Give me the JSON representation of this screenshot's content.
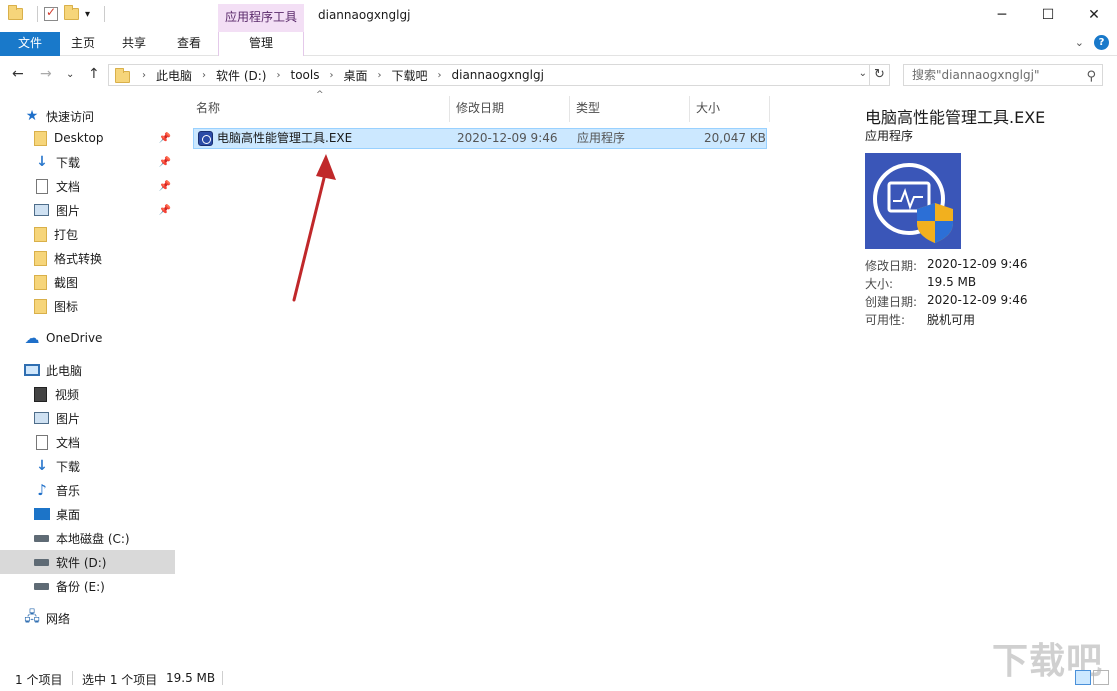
{
  "window": {
    "title": "diannaogxnglgj",
    "context_tab_group": "应用程序工具"
  },
  "ribbon": {
    "tabs": [
      {
        "label": "文件"
      },
      {
        "label": "主页"
      },
      {
        "label": "共享"
      },
      {
        "label": "查看"
      },
      {
        "label": "管理"
      }
    ]
  },
  "address": {
    "crumbs": [
      "此电脑",
      "软件 (D:)",
      "tools",
      "桌面",
      "下载吧",
      "diannaogxnglgj"
    ],
    "search_placeholder": "搜索\"diannaogxnglgj\""
  },
  "sidebar": {
    "quick_access": "快速访问",
    "quick_items": [
      "Desktop",
      "下载",
      "文档",
      "图片",
      "打包",
      "格式转换",
      "截图",
      "图标"
    ],
    "onedrive": "OneDrive",
    "this_pc": "此电脑",
    "pc_items": [
      "视频",
      "图片",
      "文档",
      "下载",
      "音乐",
      "桌面",
      "本地磁盘 (C:)",
      "软件 (D:)",
      "备份 (E:)"
    ],
    "network": "网络"
  },
  "columns": {
    "name": "名称",
    "modified": "修改日期",
    "type": "类型",
    "size": "大小"
  },
  "files": [
    {
      "name": "电脑高性能管理工具.EXE",
      "modified": "2020-12-09 9:46",
      "type": "应用程序",
      "size": "20,047 KB"
    }
  ],
  "details": {
    "title": "电脑高性能管理工具.EXE",
    "type": "应用程序",
    "fields": [
      {
        "key": "修改日期:",
        "value": "2020-12-09 9:46"
      },
      {
        "key": "大小:",
        "value": "19.5 MB"
      },
      {
        "key": "创建日期:",
        "value": "2020-12-09 9:46"
      },
      {
        "key": "可用性:",
        "value": "脱机可用"
      }
    ]
  },
  "status": {
    "count": "1 个项目",
    "selected": "选中 1 个项目",
    "size": "19.5 MB"
  },
  "watermark": "下载吧",
  "colors": {
    "accent": "#1979ca",
    "selection": "#cce8ff",
    "context_tab": "#f3dff5",
    "arrow": "#c0282a"
  }
}
